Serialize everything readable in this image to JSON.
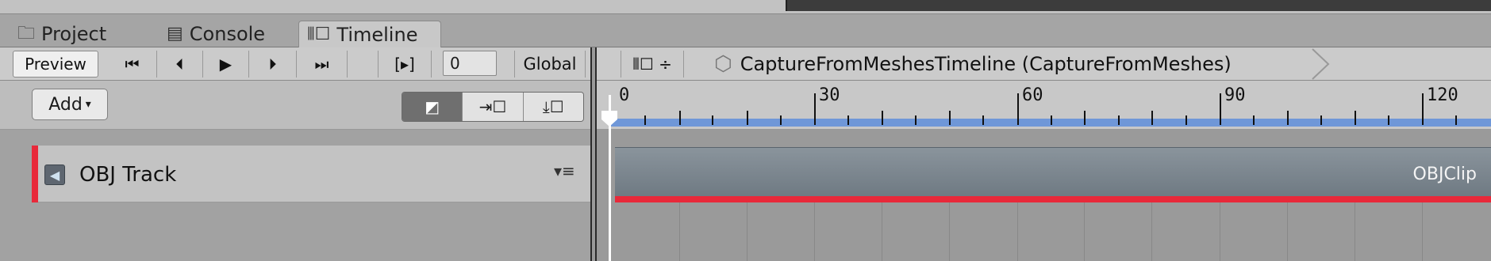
{
  "tabs": [
    {
      "label": "Project",
      "icon": "folder-icon"
    },
    {
      "label": "Console",
      "icon": "console-icon"
    },
    {
      "label": "Timeline",
      "icon": "timeline-icon",
      "active": true
    }
  ],
  "toolbar": {
    "preview_label": "Preview",
    "frame_value": "0",
    "global_label": "Global",
    "lock_label": "⦀☐ ÷",
    "breadcrumb": "CaptureFromMeshesTimeline (CaptureFromMeshes)"
  },
  "left": {
    "add_label": "Add",
    "track_name": "OBJ Track"
  },
  "ruler": {
    "labels": [
      "0",
      "30",
      "60",
      "90",
      "120"
    ]
  },
  "clip": {
    "name": "OBJClip"
  },
  "colors": {
    "track_accent": "#e8293a",
    "ruler_bar": "#6f97d8"
  }
}
